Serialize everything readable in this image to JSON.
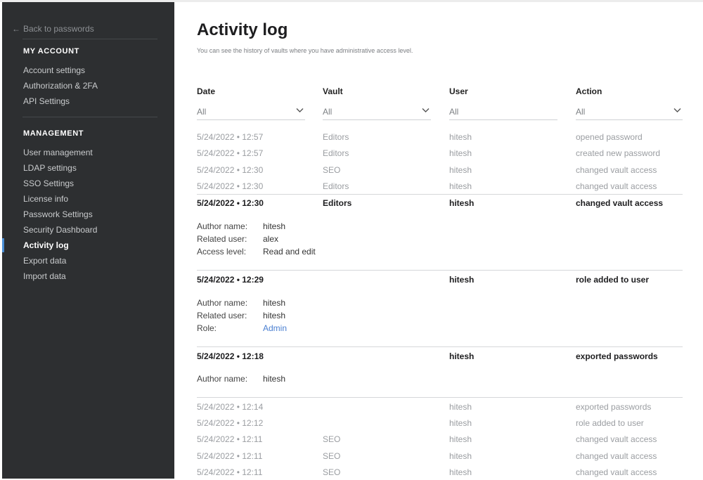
{
  "sidebar": {
    "back_label": "Back to passwords",
    "my_account_heading": "MY ACCOUNT",
    "account_items": [
      "Account settings",
      "Authorization & 2FA",
      "API Settings"
    ],
    "management_heading": "MANAGEMENT",
    "management_items": [
      "User management",
      "LDAP settings",
      "SSO Settings",
      "License info",
      "Passwork Settings",
      "Security Dashboard",
      "Activity log",
      "Export data",
      "Import data"
    ],
    "active_item": "Activity log"
  },
  "page": {
    "title": "Activity log",
    "subtitle": "You can see the history of vaults where you have administrative access level."
  },
  "columns": {
    "date": "Date",
    "vault": "Vault",
    "user": "User",
    "action": "Action"
  },
  "filters": {
    "date": "All",
    "vault": "All",
    "user": "All",
    "action": "All"
  },
  "rows_top": [
    {
      "date": "5/24/2022 • 12:57",
      "vault": "Editors",
      "user": "hitesh",
      "action": "opened password"
    },
    {
      "date": "5/24/2022 • 12:57",
      "vault": "Editors",
      "user": "hitesh",
      "action": "created new password"
    },
    {
      "date": "5/24/2022 • 12:30",
      "vault": "SEO",
      "user": "hitesh",
      "action": "changed vault access"
    },
    {
      "date": "5/24/2022 • 12:30",
      "vault": "Editors",
      "user": "hitesh",
      "action": "changed vault access"
    }
  ],
  "expanded": [
    {
      "date": "5/24/2022 • 12:30",
      "vault": "Editors",
      "user": "hitesh",
      "action": "changed vault access",
      "details": [
        {
          "key": "Author name:",
          "value": "hitesh"
        },
        {
          "key": "Related user:",
          "value": "alex"
        },
        {
          "key": "Access level:",
          "value": "Read and edit"
        }
      ]
    },
    {
      "date": "5/24/2022 • 12:29",
      "vault": "",
      "user": "hitesh",
      "action": "role added to user",
      "details": [
        {
          "key": "Author name:",
          "value": "hitesh"
        },
        {
          "key": "Related user:",
          "value": "hitesh"
        },
        {
          "key": "Role:",
          "value": "Admin"
        }
      ]
    },
    {
      "date": "5/24/2022 • 12:18",
      "vault": "",
      "user": "hitesh",
      "action": "exported passwords",
      "details": [
        {
          "key": "Author name:",
          "value": "hitesh"
        }
      ]
    }
  ],
  "rows_bottom": [
    {
      "date": "5/24/2022 • 12:14",
      "vault": "",
      "user": "hitesh",
      "action": "exported passwords"
    },
    {
      "date": "5/24/2022 • 12:12",
      "vault": "",
      "user": "hitesh",
      "action": "role added to user"
    },
    {
      "date": "5/24/2022 • 12:11",
      "vault": "SEO",
      "user": "hitesh",
      "action": "changed vault access"
    },
    {
      "date": "5/24/2022 • 12:11",
      "vault": "SEO",
      "user": "hitesh",
      "action": "changed vault access"
    },
    {
      "date": "5/24/2022 • 12:11",
      "vault": "SEO",
      "user": "hitesh",
      "action": "changed vault access"
    }
  ],
  "colors": {
    "sidebar_bg": "#2d2f31",
    "active_indicator": "#4a8fd6",
    "link": "#4a7fd1"
  }
}
